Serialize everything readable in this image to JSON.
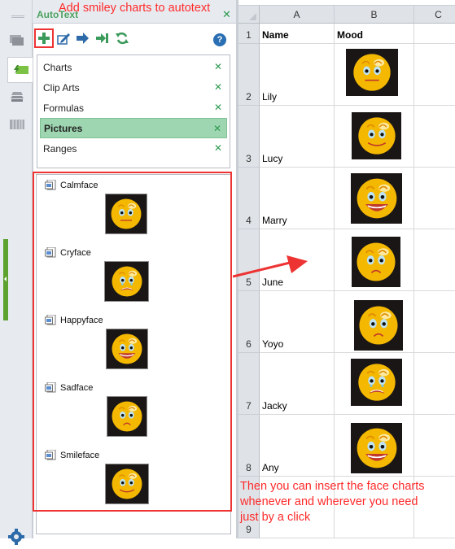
{
  "pane": {
    "title": "AutoText",
    "close_icon": "close-icon",
    "toolbar": [
      {
        "name": "add-autotext-button",
        "icon": "plus-icon",
        "tooltip": "Add"
      },
      {
        "name": "edit-autotext-button",
        "icon": "edit-icon"
      },
      {
        "name": "insert-button",
        "icon": "arrow-right-icon"
      },
      {
        "name": "insert-end-button",
        "icon": "arrow-to-end-icon"
      },
      {
        "name": "refresh-button",
        "icon": "refresh-icon"
      }
    ],
    "help_label": "?",
    "categories": [
      {
        "label": "Charts",
        "selected": false
      },
      {
        "label": "Clip Arts",
        "selected": false
      },
      {
        "label": "Formulas",
        "selected": false
      },
      {
        "label": "Pictures",
        "selected": true
      },
      {
        "label": "Ranges",
        "selected": false
      }
    ],
    "entries": [
      {
        "label": "Calmface",
        "mood": "calm"
      },
      {
        "label": "Cryface",
        "mood": "cry"
      },
      {
        "label": "Happyface",
        "mood": "happy"
      },
      {
        "label": "Sadface",
        "mood": "sad"
      },
      {
        "label": "Smileface",
        "mood": "smile"
      }
    ]
  },
  "sidebar": {
    "tabs": [
      "resources-icon",
      "autotext-icon",
      "layers-icon",
      "columns-icon"
    ],
    "active_tab": 1,
    "settings_icon": "gear-icon"
  },
  "sheet": {
    "columns": [
      "A",
      "B",
      "C"
    ],
    "header_row": {
      "row": "1",
      "a": "Name",
      "b": "Mood"
    },
    "rows": [
      {
        "row": "2",
        "name": "Lily",
        "mood": "calm"
      },
      {
        "row": "3",
        "name": "Lucy",
        "mood": "smile"
      },
      {
        "row": "4",
        "name": "Marry",
        "mood": "happy"
      },
      {
        "row": "5",
        "name": "June",
        "mood": "sad"
      },
      {
        "row": "6",
        "name": "Yoyo",
        "mood": "sad"
      },
      {
        "row": "7",
        "name": "Jacky",
        "mood": "cry"
      },
      {
        "row": "8",
        "name": "Any",
        "mood": "happy"
      }
    ],
    "last_row": "9"
  },
  "annotations": {
    "top": "Add smiley charts to autotext",
    "bottom": "Then you can insert the face charts whenever and wherever you need just by a click"
  },
  "colors": {
    "accent_green": "#4ea261",
    "selection_green": "#9ed6b1",
    "annotation_red": "#ff2a2a",
    "face_yellow": "#f4b800"
  }
}
